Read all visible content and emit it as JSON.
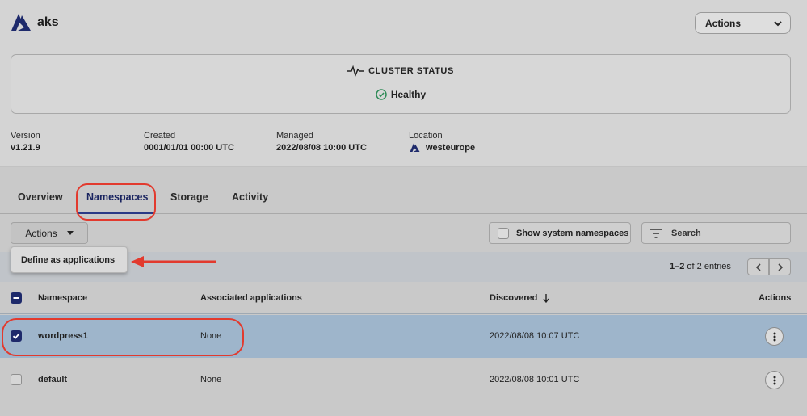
{
  "header": {
    "title": "aks",
    "actions_label": "Actions"
  },
  "cluster_status": {
    "title": "CLUSTER STATUS",
    "value": "Healthy"
  },
  "meta": {
    "version_label": "Version",
    "version_value": "v1.21.9",
    "created_label": "Created",
    "created_value": "0001/01/01 00:00 UTC",
    "managed_label": "Managed",
    "managed_value": "2022/08/08 10:00 UTC",
    "location_label": "Location",
    "location_value": "westeurope"
  },
  "tabs": [
    {
      "label": "Overview"
    },
    {
      "label": "Namespaces"
    },
    {
      "label": "Storage"
    },
    {
      "label": "Activity"
    }
  ],
  "toolbar": {
    "actions_label": "Actions",
    "show_system_label": "Show system namespaces",
    "search_placeholder": "Search"
  },
  "dropdown": {
    "items": [
      {
        "label": "Define as applications"
      }
    ]
  },
  "pagination": {
    "range": "1–2",
    "of_text": "of 2 entries"
  },
  "table": {
    "headers": {
      "namespace": "Namespace",
      "associated": "Associated applications",
      "discovered": "Discovered",
      "actions": "Actions"
    },
    "rows": [
      {
        "namespace": "wordpress1",
        "associated": "None",
        "discovered": "2022/08/08 10:07 UTC",
        "selected": true
      },
      {
        "namespace": "default",
        "associated": "None",
        "discovered": "2022/08/08 10:01 UTC",
        "selected": false
      }
    ]
  },
  "colors": {
    "annotation_red": "#e23a2e",
    "brand_navy": "#1e2a6b",
    "selected_row": "#9eb5cb"
  }
}
